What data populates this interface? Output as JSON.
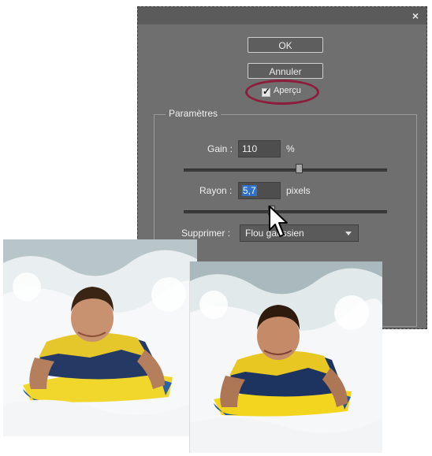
{
  "dialog": {
    "close_glyph": "×",
    "ok_label": "OK",
    "cancel_label": "Annuler",
    "preview_label": "Aperçu",
    "preview_checked": true,
    "group_title": "Paramètres",
    "gain": {
      "label": "Gain :",
      "value": "110",
      "unit": "%"
    },
    "rayon": {
      "label": "Rayon :",
      "value": "5,7",
      "unit": "pixels"
    },
    "supprimer": {
      "label": "Supprimer :",
      "value": "Flou gaussien"
    }
  },
  "icons": [
    "close-icon",
    "checkmark-icon",
    "dropdown-arrow-icon",
    "cursor-arrow-icon"
  ],
  "colors": {
    "dialog_bg": "#6f6f6f",
    "highlight_ring": "#8d1d3c",
    "selection": "#2f71c9"
  }
}
